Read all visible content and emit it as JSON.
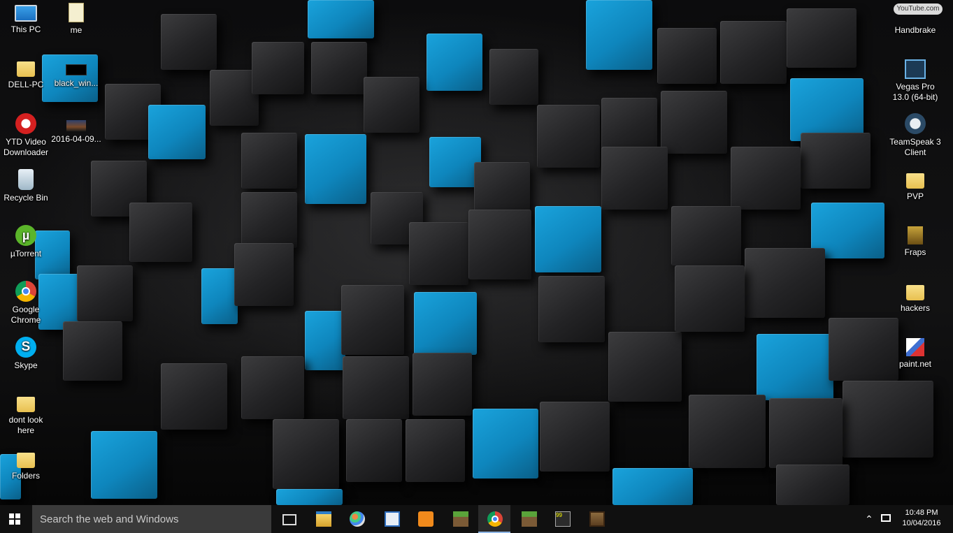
{
  "desktop": {
    "watermark": "YouTube.com",
    "left_icons": [
      {
        "label": "This PC",
        "icon": "computer-icon"
      },
      {
        "label": "me",
        "icon": "file-icon"
      },
      {
        "label": "DELL-PC",
        "icon": "user-folder-icon"
      },
      {
        "label": "black_win...",
        "icon": "image-file-icon"
      },
      {
        "label": "YTD Video Downloader",
        "icon": "ytd-icon"
      },
      {
        "label": "2016-04-09...",
        "icon": "photo-icon"
      },
      {
        "label": "Recycle Bin",
        "icon": "recycle-bin-icon"
      },
      {
        "label": "µTorrent",
        "icon": "utorrent-icon"
      },
      {
        "label": "Google Chrome",
        "icon": "chrome-icon"
      },
      {
        "label": "Skype",
        "icon": "skype-icon"
      },
      {
        "label": "dont look here",
        "icon": "folder-icon"
      },
      {
        "label": "Folders",
        "icon": "folder-icon"
      }
    ],
    "right_icons": [
      {
        "label": "Handbrake",
        "icon": "handbrake-icon"
      },
      {
        "label": "Vegas Pro 13.0 (64-bit)",
        "icon": "vegas-pro-icon"
      },
      {
        "label": "TeamSpeak 3 Client",
        "icon": "teamspeak-icon"
      },
      {
        "label": "PVP",
        "icon": "folder-icon"
      },
      {
        "label": "Fraps",
        "icon": "fraps-icon"
      },
      {
        "label": "hackers",
        "icon": "folder-icon"
      },
      {
        "label": "paint.net",
        "icon": "paintnet-icon"
      }
    ]
  },
  "taskbar": {
    "search_placeholder": "Search the web and Windows",
    "pinned": [
      {
        "name": "task-view",
        "icon": "task-view-icon"
      },
      {
        "name": "file-explorer",
        "icon": "folder-icon"
      },
      {
        "name": "paint",
        "icon": "palette-icon"
      },
      {
        "name": "app-window",
        "icon": "window-icon"
      },
      {
        "name": "media-player",
        "icon": "media-player-icon"
      },
      {
        "name": "minecraft",
        "icon": "minecraft-icon"
      },
      {
        "name": "chrome",
        "icon": "chrome-icon",
        "active": true
      },
      {
        "name": "minecraft-2",
        "icon": "minecraft-icon"
      },
      {
        "name": "fraps",
        "icon": "fraps-icon"
      },
      {
        "name": "crafting-table",
        "icon": "crafting-table-icon"
      }
    ],
    "fraps_counter": "99",
    "clock": {
      "time": "10:48 PM",
      "date": "10/04/2016"
    }
  }
}
